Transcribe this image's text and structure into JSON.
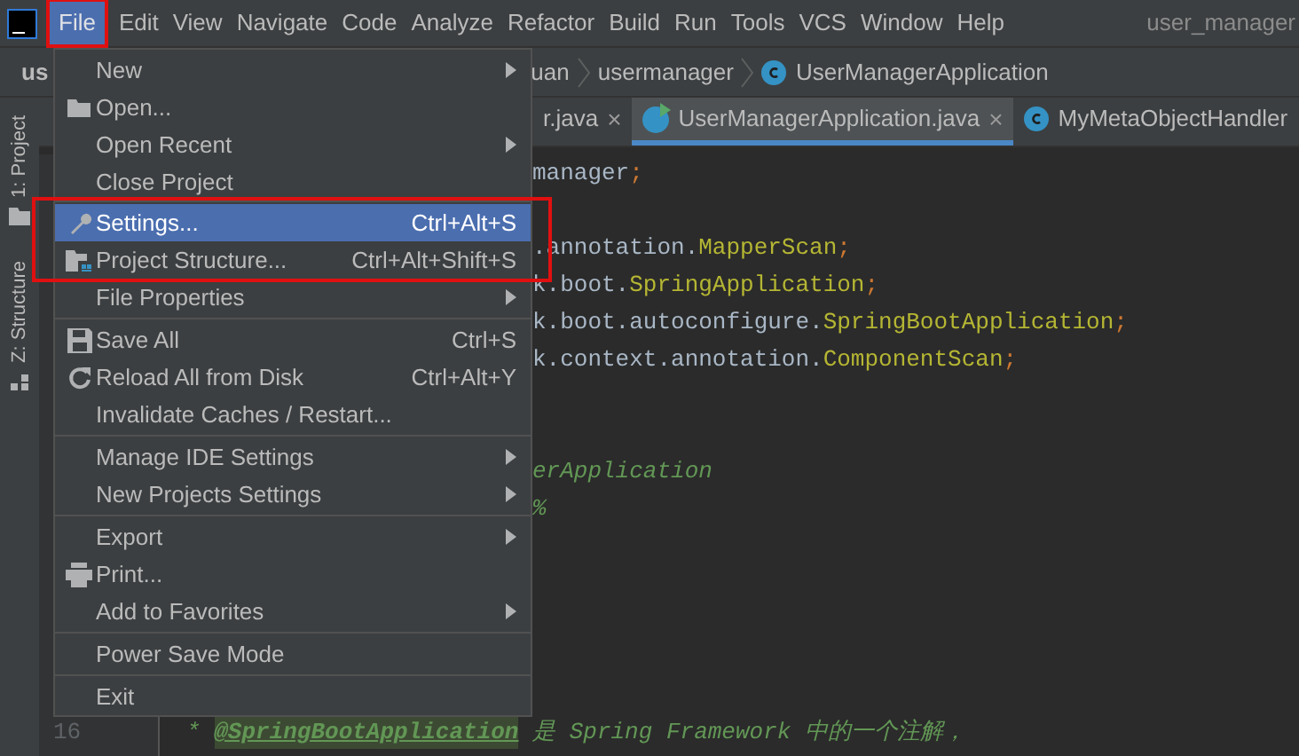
{
  "menu_bar": {
    "items": [
      {
        "label": "File",
        "selected": true
      },
      {
        "label": "Edit",
        "selected": false
      },
      {
        "label": "View",
        "selected": false
      },
      {
        "label": "Navigate",
        "selected": false
      },
      {
        "label": "Code",
        "selected": false
      },
      {
        "label": "Analyze",
        "selected": false
      },
      {
        "label": "Refactor",
        "selected": false
      },
      {
        "label": "Build",
        "selected": false
      },
      {
        "label": "Run",
        "selected": false
      },
      {
        "label": "Tools",
        "selected": false
      },
      {
        "label": "VCS",
        "selected": false
      },
      {
        "label": "Window",
        "selected": false
      },
      {
        "label": "Help",
        "selected": false
      }
    ],
    "project_title": "user_manager"
  },
  "navigation_bar": {
    "project": "us",
    "breadcrumbs": [
      {
        "label": "uan",
        "kind": "folder"
      },
      {
        "label": "usermanager",
        "kind": "folder"
      },
      {
        "label": "UserManagerApplication",
        "kind": "class"
      }
    ]
  },
  "tool_strip": [
    {
      "label": "1: Project"
    },
    {
      "label": "Z: Structure"
    }
  ],
  "tabs": [
    {
      "label": "r.java",
      "selected": false,
      "kind": "plain",
      "close": "×"
    },
    {
      "label": "UserManagerApplication.java",
      "selected": true,
      "kind": "app",
      "close": "×"
    },
    {
      "label": "MyMetaObjectHandler",
      "selected": false,
      "kind": "class"
    }
  ],
  "file_menu": {
    "groups": [
      [
        {
          "label": "New",
          "kind": "plain",
          "submenu": true,
          "selected": false
        },
        {
          "label": "Open...",
          "kind": "open",
          "submenu": false,
          "selected": false
        },
        {
          "label": "Open Recent",
          "kind": "plain",
          "submenu": true,
          "selected": false
        },
        {
          "label": "Close Project",
          "kind": "plain",
          "submenu": false,
          "selected": false
        }
      ],
      [
        {
          "label": "Settings...",
          "kind": "settings",
          "shortcut": "Ctrl+Alt+S",
          "submenu": false,
          "selected": true
        },
        {
          "label": "Project Structure...",
          "kind": "structure",
          "shortcut": "Ctrl+Alt+Shift+S",
          "submenu": false,
          "selected": false
        },
        {
          "label": "File Properties",
          "kind": "plain",
          "submenu": true,
          "selected": false
        }
      ],
      [
        {
          "label": "Save All",
          "kind": "save",
          "shortcut": "Ctrl+S",
          "submenu": false,
          "selected": false
        },
        {
          "label": "Reload All from Disk",
          "kind": "reload",
          "shortcut": "Ctrl+Alt+Y",
          "submenu": false,
          "selected": false
        },
        {
          "label": "Invalidate Caches / Restart...",
          "kind": "plain",
          "submenu": false,
          "selected": false
        }
      ],
      [
        {
          "label": "Manage IDE Settings",
          "kind": "plain",
          "submenu": true,
          "selected": false
        },
        {
          "label": "New Projects Settings",
          "kind": "plain",
          "submenu": true,
          "selected": false
        }
      ],
      [
        {
          "label": "Export",
          "kind": "plain",
          "submenu": true,
          "selected": false
        },
        {
          "label": "Print...",
          "kind": "print",
          "submenu": false,
          "selected": false
        },
        {
          "label": "Add to Favorites",
          "kind": "plain",
          "submenu": true,
          "selected": false
        }
      ],
      [
        {
          "label": "Power Save Mode",
          "kind": "plain",
          "submenu": false,
          "selected": false
        }
      ],
      [
        {
          "label": "Exit",
          "kind": "plain",
          "submenu": false,
          "selected": false
        }
      ]
    ]
  },
  "code_lines": [
    {
      "kind": "clipped",
      "tokens": [
        {
          "text": "manager",
          "kind": "plain"
        },
        {
          "text": ";",
          "kind": "punct"
        }
      ]
    },
    {
      "kind": "clipped"
    },
    {
      "kind": "clipped",
      "tokens": [
        {
          "text": ".annotation.",
          "kind": "plain"
        },
        {
          "text": "MapperScan",
          "kind": "class"
        },
        {
          "text": ";",
          "kind": "punct"
        }
      ]
    },
    {
      "kind": "clipped",
      "tokens": [
        {
          "text": "k.boot.",
          "kind": "plain"
        },
        {
          "text": "SpringApplication",
          "kind": "class"
        },
        {
          "text": ";",
          "kind": "punct"
        }
      ]
    },
    {
      "kind": "clipped",
      "tokens": [
        {
          "text": "k.boot.autoconfigure.",
          "kind": "plain"
        },
        {
          "text": "SpringBootApplication",
          "kind": "class"
        },
        {
          "text": ";",
          "kind": "punct"
        }
      ]
    },
    {
      "kind": "clipped",
      "tokens": [
        {
          "text": "k.context.annotation.",
          "kind": "plain"
        },
        {
          "text": "ComponentScan",
          "kind": "class"
        },
        {
          "text": ";",
          "kind": "punct"
        }
      ]
    },
    {
      "kind": "clipped"
    },
    {
      "kind": "clipped"
    },
    {
      "kind": "clipped",
      "tokens": [
        {
          "text": "erApplication",
          "kind": "comment"
        }
      ]
    },
    {
      "kind": "clipped",
      "tokens": [
        {
          "text": "%",
          "kind": "comment"
        }
      ]
    },
    {
      "kind": "clipped"
    },
    {
      "kind": "clipped"
    },
    {
      "kind": "clipped"
    },
    {
      "kind": "clipped"
    },
    {
      "kind": "clipped"
    },
    {
      "kind": "full",
      "number": "16",
      "tokens": [
        {
          "text": "* ",
          "kind": "comment"
        },
        {
          "text": "@SpringBootApplication",
          "kind": "doctag"
        },
        {
          "text": " 是 Spring Framework 中的一个注解，",
          "kind": "comment"
        }
      ]
    }
  ]
}
